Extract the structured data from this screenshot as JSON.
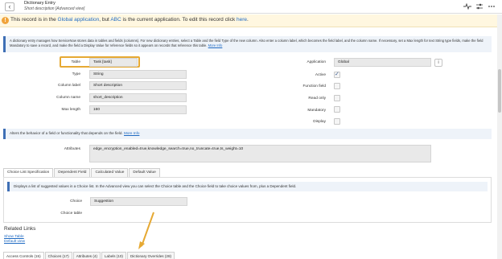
{
  "header": {
    "back_glyph": "‹",
    "title": "Dictionary Entry",
    "subtitle": "Short description [Advanced view]",
    "icons": [
      "activity-icon",
      "settings-sliders-icon",
      "more-icon"
    ]
  },
  "banner": {
    "prefix": "This record is in the ",
    "scope_link": "Global application",
    "middle": ", but ",
    "current_app": "ABC",
    "suffix": " is the current application. To edit this record click ",
    "here_link": "here",
    "end": "."
  },
  "description": {
    "text": "A dictionary entry manages how ServiceNow stores data in tables and fields (columns). For new dictionary entries, select a Table and the field Type of the new column. Also enter a column label, which becomes the field label, and the column name. If necessary, set a Max length for text String type fields, make the field Mandatory to save a record, and make the field a Display Value for reference fields so it appears on records that reference this table. ",
    "more_link": "More Info"
  },
  "form": {
    "table_label": "Table",
    "table_value": "Task [task]",
    "type_label": "Type",
    "type_value": "String",
    "column_label_label": "Column label",
    "column_label_value": "Short description",
    "column_name_label": "Column name",
    "column_name_value": "short_description",
    "max_length_label": "Max length",
    "max_length_value": "160",
    "application_label": "Application",
    "application_value": "Global",
    "info_glyph": "i",
    "active_label": "Active",
    "active_checked": true,
    "function_field_label": "Function field",
    "read_only_label": "Read only",
    "mandatory_label": "Mandatory",
    "display_label": "Display"
  },
  "behavior": {
    "text": "Alters the behavior of a field or functionality that depends on the field. ",
    "more_link": "More Info"
  },
  "attributes": {
    "label": "Attributes",
    "value": "edge_encryption_enabled=true,knowledge_search=true,no_truncate=true,ts_weight=10"
  },
  "tabs": [
    "Choice List Specification",
    "Dependent Field",
    "Calculated Value",
    "Default Value"
  ],
  "choice_panel": {
    "info": "Displays a list of suggested values in a Choice list. In the Advanced view you can select the Choice table and the Choice field to take choice values from, plus a Dependent field.",
    "choice_label": "Choice",
    "choice_value": "Suggestion",
    "choice_table_label": "Choice table"
  },
  "related": {
    "title": "Related Links",
    "links": [
      "Show Table",
      "Default view"
    ]
  },
  "bottom_tabs": [
    "Access Controls (15)",
    "Choices (17)",
    "Attributes (4)",
    "Labels (10)",
    "Dictionary Overrides (28)"
  ],
  "colors": {
    "accent": "#3f6fb5",
    "highlight": "#e6a933",
    "banner_bg": "#fff7e0",
    "link": "#1f6ac2"
  }
}
